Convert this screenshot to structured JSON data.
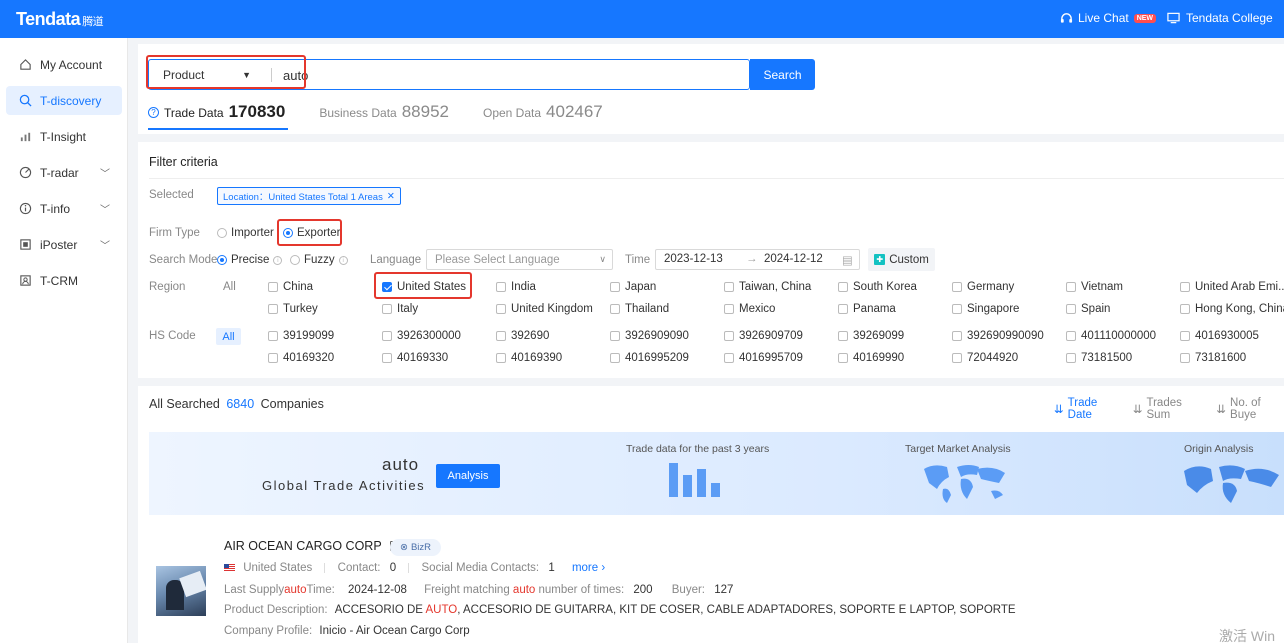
{
  "topbar": {
    "logo": "Tendata",
    "logo_cn": "腾道",
    "live_chat": "Live Chat",
    "new_badge": "NEW",
    "college": "Tendata College"
  },
  "sidebar": {
    "items": [
      {
        "label": "My Account",
        "icon": "home-icon"
      },
      {
        "label": "T-discovery",
        "icon": "search-icon"
      },
      {
        "label": "T-Insight",
        "icon": "chart-icon"
      },
      {
        "label": "T-radar",
        "icon": "radar-icon"
      },
      {
        "label": "T-info",
        "icon": "info-icon"
      },
      {
        "label": "iPoster",
        "icon": "poster-icon"
      },
      {
        "label": "T-CRM",
        "icon": "crm-icon"
      }
    ]
  },
  "search": {
    "type": "Product",
    "query": "auto",
    "button": "Search"
  },
  "tabs": [
    {
      "label": "Trade Data",
      "count": "170830"
    },
    {
      "label": "Business Data",
      "count": "88952"
    },
    {
      "label": "Open Data",
      "count": "402467"
    }
  ],
  "filter": {
    "title": "Filter criteria",
    "selected_label": "Selected",
    "selected_tag": "Location：United States Total 1 Areas",
    "firm_type_label": "Firm Type",
    "firm_types": [
      "Importer",
      "Exporter"
    ],
    "firm_type_selected": "Exporter",
    "search_mode_label": "Search Mode",
    "search_modes": [
      "Precise",
      "Fuzzy"
    ],
    "search_mode_selected": "Precise",
    "language_label": "Language",
    "language_placeholder": "Please Select Language",
    "time_label": "Time",
    "date_from": "2023-12-13",
    "date_arrow": "→",
    "date_to": "2024-12-12",
    "custom": "Custom",
    "region_label": "Region",
    "all": "All",
    "regions_row1": [
      "China",
      "United States",
      "India",
      "Japan",
      "Taiwan, China",
      "South Korea",
      "Germany",
      "Vietnam",
      "United Arab Emi..."
    ],
    "regions_row2": [
      "Turkey",
      "Italy",
      "United Kingdom",
      "Thailand",
      "Mexico",
      "Panama",
      "Singapore",
      "Spain",
      "Hong Kong, China"
    ],
    "region_checked": "United States",
    "hs_label": "HS Code",
    "hs_row1": [
      "39199099",
      "3926300000",
      "392690",
      "3926909090",
      "3926909709",
      "39269099",
      "392690990090",
      "401110000000",
      "4016930005"
    ],
    "hs_row2": [
      "40169320",
      "40169330",
      "40169390",
      "4016995209",
      "4016995709",
      "40169990",
      "72044920",
      "73181500",
      "73181600"
    ]
  },
  "results": {
    "prefix": "All Searched",
    "count": "6840",
    "suffix": "Companies",
    "sort": [
      "Trade Date",
      "Trades Sum",
      "No. of Buye"
    ],
    "banner": {
      "keyword": "auto",
      "subtitle": "Global Trade Activities",
      "analysis": "Analysis",
      "cap1": "Trade data for the past 3 years",
      "cap2": "Target Market Analysis",
      "cap3": "Origin Analysis"
    },
    "company": {
      "name": "AIR OCEAN CARGO CORP",
      "tag": "BizR",
      "country": "United States",
      "contact_label": "Contact:",
      "contact": "0",
      "social_label": "Social Media Contacts:",
      "social": "1",
      "more": "more",
      "last_supply_pre": "Last Supply",
      "last_supply_kw": "auto",
      "last_supply_post": "Time:",
      "last_supply": "2024-12-08",
      "freight_pre": "Freight matching",
      "freight_kw": "auto",
      "freight_post": "number of times:",
      "freight": "200",
      "buyer_label": "Buyer:",
      "buyer": "127",
      "desc_label": "Product Description:",
      "desc_a": "ACCESORIO DE",
      "desc_kw": "AUTO",
      "desc_b": ", ACCESORIO DE GUITARRA, KIT DE COSER, CABLE ADAPTADORES, SOPORTE E LAPTOP, SOPORTE",
      "profile_label": "Company Profile:",
      "profile": "Inicio - Air Ocean Cargo Corp"
    }
  },
  "watermark": "激活 Win"
}
